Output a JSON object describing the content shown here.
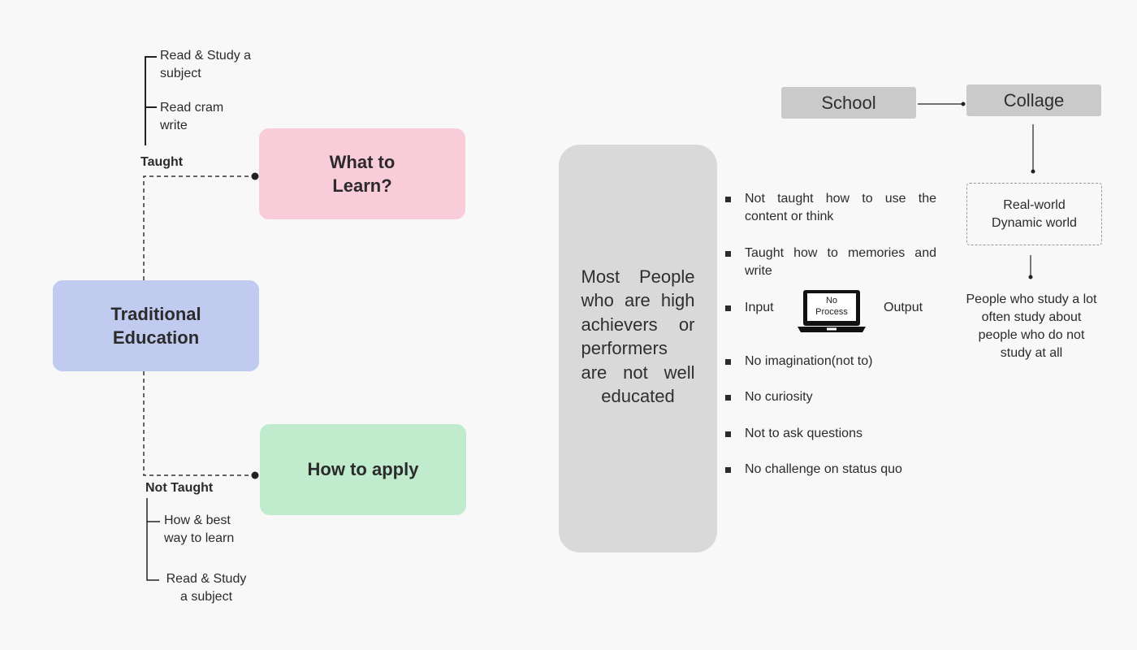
{
  "diagram": {
    "root": {
      "label": "Traditional Education",
      "color": "#c0cbef"
    },
    "branches": [
      {
        "relation": "Taught",
        "node": {
          "label": "What to Learn?",
          "color": "#f8ccd8"
        },
        "items": [
          "Read & Study a subject",
          "Read cram write"
        ]
      },
      {
        "relation": "Not Taught",
        "node": {
          "label": "How to apply",
          "color": "#c0ebcd"
        },
        "items": [
          "How & best way to learn",
          "Read & Study a subject"
        ]
      }
    ],
    "center_statement": "Most People who are high achievers or performers are not well educated",
    "bullets": [
      "Not taught how to use the content or think",
      "Taught how to memories and write",
      {
        "input": "Input",
        "laptop_screen": "No Process",
        "output": "Output"
      },
      "No imagination(not to)",
      "No curiosity",
      "Not to ask questions",
      "No challenge on status quo"
    ],
    "flow": {
      "school": "School",
      "college": "Collage",
      "real_world": "Real-world Dynamic world",
      "conclusion": "People who study a lot often study about people who do not study at all"
    }
  }
}
